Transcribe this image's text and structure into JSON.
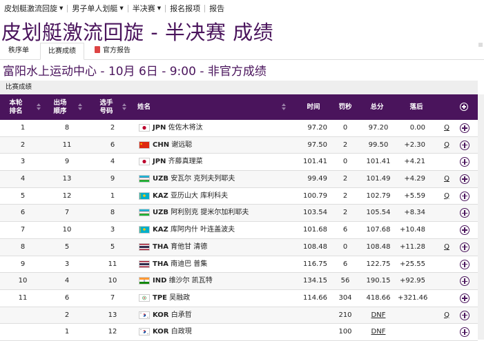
{
  "nav": [
    {
      "label": "皮划艇激流回旋",
      "dropdown": true
    },
    {
      "label": "男子单人划艇",
      "dropdown": true
    },
    {
      "label": "半决赛",
      "dropdown": true
    },
    {
      "label": "报名报项",
      "dropdown": false
    },
    {
      "label": "报告",
      "dropdown": false
    }
  ],
  "title": "皮划艇激流回旋 - 半决赛 成绩",
  "tabs": [
    {
      "label": "秩序单"
    },
    {
      "label": "比赛成绩"
    },
    {
      "label": "官方报告"
    }
  ],
  "subtitle": "富阳水上运动中心 - 10月 6日 - 9:00 - 非官方成绩",
  "section_label": "比赛成绩",
  "headers": {
    "rank": [
      "本轮",
      "排名"
    ],
    "order": [
      "出场",
      "顺序"
    ],
    "bib": [
      "选手",
      "号码"
    ],
    "name": "姓名",
    "time": "时间",
    "penalty": "罚秒",
    "total": "总分",
    "behind": "落后"
  },
  "rows": [
    {
      "rank": "1",
      "order": "8",
      "bib": "2",
      "flag": "JPN",
      "noc": "JPN",
      "name": "佐佐木将汰",
      "time": "97.20",
      "pen": "0",
      "total": "97.20",
      "behind": "0.00",
      "q": "Q"
    },
    {
      "rank": "2",
      "order": "11",
      "bib": "6",
      "flag": "CHN",
      "noc": "CHN",
      "name": "谢远聪",
      "time": "97.50",
      "pen": "2",
      "total": "99.50",
      "behind": "+2.30",
      "q": "Q"
    },
    {
      "rank": "3",
      "order": "9",
      "bib": "4",
      "flag": "JPN",
      "noc": "JPN",
      "name": "齐藤真理菜",
      "time": "101.41",
      "pen": "0",
      "total": "101.41",
      "behind": "+4.21",
      "q": ""
    },
    {
      "rank": "4",
      "order": "13",
      "bib": "9",
      "flag": "UZB",
      "noc": "UZB",
      "name": "安瓦尔 克列夫列耶夫",
      "time": "99.49",
      "pen": "2",
      "total": "101.49",
      "behind": "+4.29",
      "q": "Q"
    },
    {
      "rank": "5",
      "order": "12",
      "bib": "1",
      "flag": "KAZ",
      "noc": "KAZ",
      "name": "亚历山大 库利科夫",
      "time": "100.79",
      "pen": "2",
      "total": "102.79",
      "behind": "+5.59",
      "q": "Q"
    },
    {
      "rank": "6",
      "order": "7",
      "bib": "8",
      "flag": "UZB",
      "noc": "UZB",
      "name": "阿利别克 提米尔加利耶夫",
      "time": "103.54",
      "pen": "2",
      "total": "105.54",
      "behind": "+8.34",
      "q": ""
    },
    {
      "rank": "7",
      "order": "10",
      "bib": "3",
      "flag": "KAZ",
      "noc": "KAZ",
      "name": "库阿内什 叶连盖波夫",
      "time": "101.68",
      "pen": "6",
      "total": "107.68",
      "behind": "+10.48",
      "q": ""
    },
    {
      "rank": "8",
      "order": "5",
      "bib": "5",
      "flag": "THA",
      "noc": "THA",
      "name": "育他甘 清德",
      "time": "108.48",
      "pen": "0",
      "total": "108.48",
      "behind": "+11.28",
      "q": "Q"
    },
    {
      "rank": "9",
      "order": "3",
      "bib": "11",
      "flag": "THA",
      "noc": "THA",
      "name": "南迪巴 普集",
      "time": "116.75",
      "pen": "6",
      "total": "122.75",
      "behind": "+25.55",
      "q": ""
    },
    {
      "rank": "10",
      "order": "4",
      "bib": "10",
      "flag": "IND",
      "noc": "IND",
      "name": "维沙尔 凯瓦特",
      "time": "134.15",
      "pen": "56",
      "total": "190.15",
      "behind": "+92.95",
      "q": ""
    },
    {
      "rank": "11",
      "order": "6",
      "bib": "7",
      "flag": "TPE",
      "noc": "TPE",
      "name": "吴融政",
      "time": "114.66",
      "pen": "304",
      "total": "418.66",
      "behind": "+321.46",
      "q": ""
    },
    {
      "rank": "",
      "order": "2",
      "bib": "13",
      "flag": "KOR",
      "noc": "KOR",
      "name": "白承哲",
      "time": "",
      "pen": "210",
      "total": "DNF",
      "behind": "",
      "q": "Q"
    },
    {
      "rank": "",
      "order": "1",
      "bib": "12",
      "flag": "KOR",
      "noc": "KOR",
      "name": "白政現",
      "time": "",
      "pen": "100",
      "total": "DNF",
      "behind": "",
      "q": ""
    }
  ],
  "colors": {
    "brand": "#4a145c",
    "header_text": "#ffffff"
  }
}
